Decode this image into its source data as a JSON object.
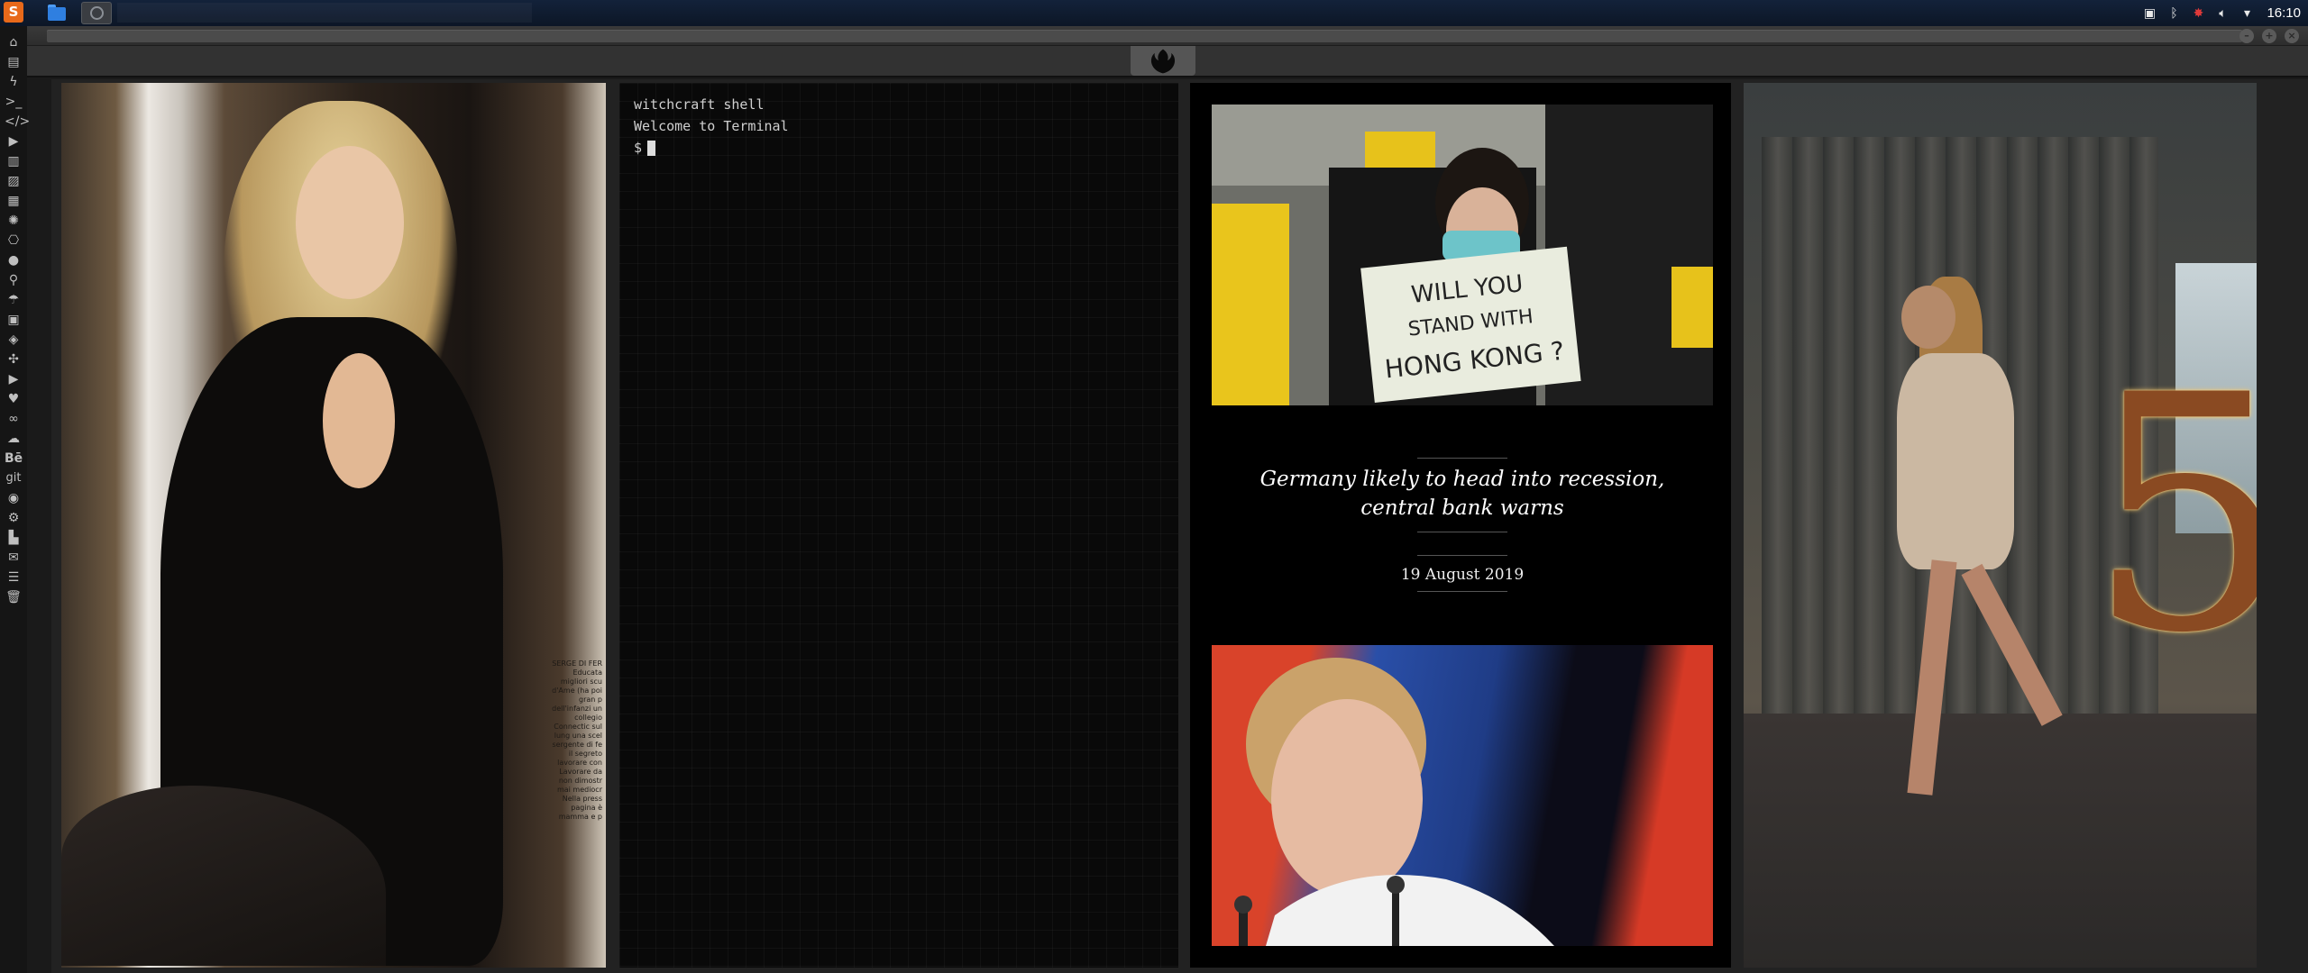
{
  "taskbar": {
    "launcher_label": "S",
    "clock": "16:10",
    "tray_icons": [
      "screenshot-icon",
      "bluetooth-icon",
      "settings-red-icon",
      "volume-icon",
      "wifi-icon"
    ]
  },
  "dock_icons": [
    "home-icon",
    "document-icon",
    "lightning-icon",
    "terminal-icon",
    "code-icon",
    "play-icon",
    "book-icon",
    "image-icon",
    "news-icon",
    "rebel-icon",
    "empire-icon",
    "globe-icon",
    "search-icon",
    "umbrella-icon",
    "contact-icon",
    "tag-icon",
    "expand-icon",
    "youtube-icon",
    "heart-icon",
    "infinity-icon",
    "cloud-icon",
    "behance-icon",
    "git-icon",
    "github-icon",
    "bitcoin-icon",
    "map-icon",
    "mail-icon",
    "server-icon",
    "trash-icon"
  ],
  "dock_labels": {
    "behance": "Bē",
    "git": "git"
  },
  "window": {
    "buttons": [
      "minimize",
      "maximize",
      "close"
    ]
  },
  "terminal": {
    "line1": "witchcraft shell",
    "line2": "Welcome to Terminal",
    "prompt": "$"
  },
  "news": {
    "image1_sign_text": "WILL YOU STAND WITH HONG KONG ?",
    "headline": "Germany likely to head into recession, central bank warns",
    "date": "19 August 2019"
  },
  "photo1": {
    "magazine_text": "SERGE DI FER Educata migliori scu d'Ame (ha poi gran p dell'infanzi un collegio Connectic sul lung una scel sergente di fe il segreto lavorare con Lavorare da non dimostr mai mediocr Nella press pagina è mamma e p"
  },
  "photo4": {
    "sign": "5"
  },
  "colors": {
    "launcher": "#e8691a",
    "folder": "#2f7fe0",
    "accent_red_tray": "#e03a3a"
  }
}
